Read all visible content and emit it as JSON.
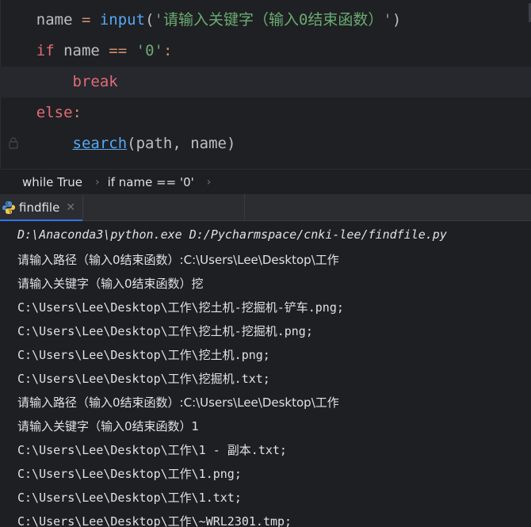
{
  "editor": {
    "lines": [
      {
        "indent": "    ",
        "parts": [
          [
            "plain",
            "name "
          ],
          [
            "kw",
            "= "
          ],
          [
            "fn",
            "input"
          ],
          [
            "punc",
            "("
          ],
          [
            "str",
            "'请输入关键字（输入0结束函数）'"
          ],
          [
            "punc",
            ")"
          ]
        ]
      },
      {
        "indent": "    ",
        "parts": [
          [
            "kwr",
            "if "
          ],
          [
            "plain",
            "name "
          ],
          [
            "kw",
            "== "
          ],
          [
            "str",
            "'0'"
          ],
          [
            "kw",
            ":"
          ]
        ]
      },
      {
        "indent": "        ",
        "parts": [
          [
            "kwr",
            "break"
          ]
        ]
      },
      {
        "indent": "    ",
        "parts": [
          [
            "kwr",
            "else"
          ],
          [
            "kw",
            ":"
          ]
        ]
      },
      {
        "indent": "        ",
        "parts": [
          [
            "fnu",
            "search"
          ],
          [
            "punc",
            "("
          ],
          [
            "plain",
            "path, name"
          ],
          [
            "punc",
            ")"
          ]
        ]
      }
    ]
  },
  "breadcrumb": {
    "item1": "while True",
    "item2": "if name == '0'"
  },
  "run_tab": {
    "label": "findfile",
    "close_icon": "close-icon"
  },
  "console": {
    "lines": [
      "D:\\Anaconda3\\python.exe D:/Pycharmspace/cnki-lee/findfile.py",
      "请输入路径（输入0结束函数）:C:\\Users\\Lee\\Desktop\\工作",
      "请输入关键字（输入0结束函数）挖",
      "C:\\Users\\Lee\\Desktop\\工作\\挖土机-挖掘机-铲车.png;",
      "C:\\Users\\Lee\\Desktop\\工作\\挖土机-挖掘机.png;",
      "C:\\Users\\Lee\\Desktop\\工作\\挖土机.png;",
      "C:\\Users\\Lee\\Desktop\\工作\\挖掘机.txt;",
      "请输入路径（输入0结束函数）:C:\\Users\\Lee\\Desktop\\工作",
      "请输入关键字（输入0结束函数）1",
      "C:\\Users\\Lee\\Desktop\\工作\\1 - 副本.txt;",
      "C:\\Users\\Lee\\Desktop\\工作\\1.png;",
      "C:\\Users\\Lee\\Desktop\\工作\\1.txt;",
      "C:\\Users\\Lee\\Desktop\\工作\\~WRL2301.tmp;"
    ]
  },
  "colors": {
    "keyword": "#cf8e6d",
    "keyword_red": "#e06c75",
    "string": "#6aab73",
    "function": "#56a8f5",
    "accent": "#3574f0"
  }
}
